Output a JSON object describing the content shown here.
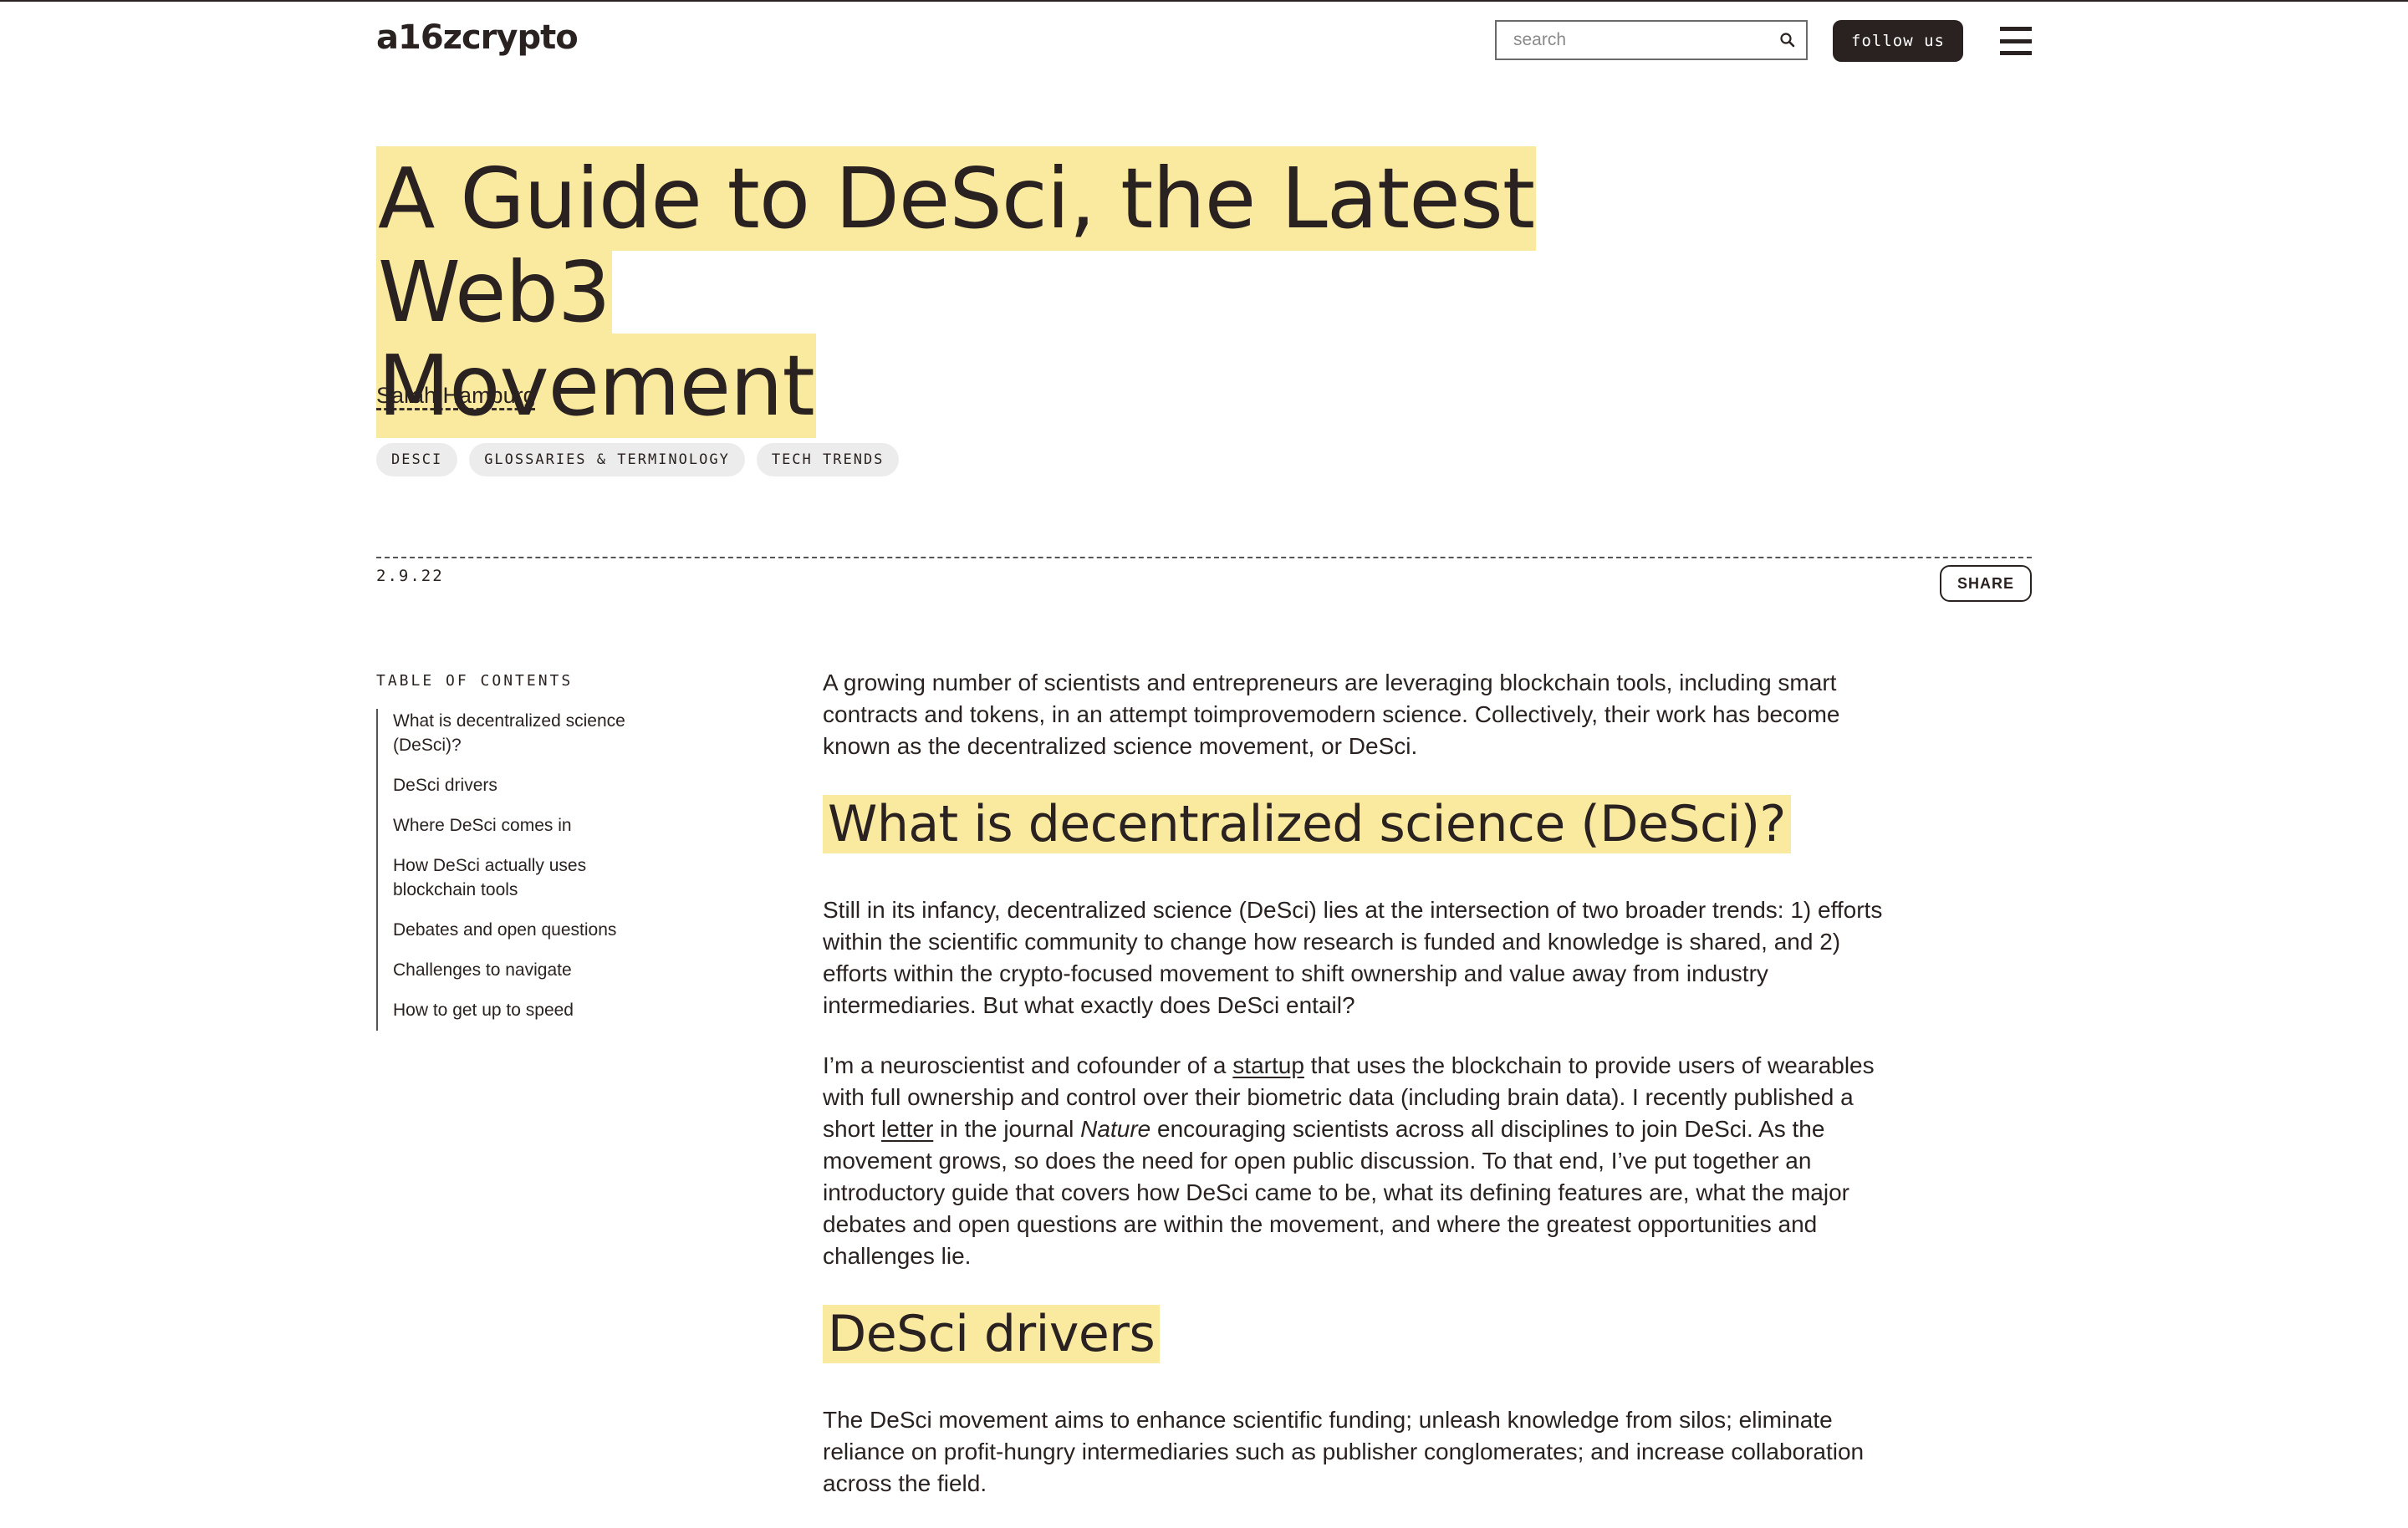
{
  "header": {
    "logo": "a16zcrypto",
    "search_placeholder": "search",
    "follow_label": "follow us"
  },
  "article": {
    "title_line1": "A Guide to DeSci, the Latest Web3",
    "title_line2": "Movement",
    "author": "Sarah Hamburg",
    "tags": [
      "DESCI",
      "GLOSSARIES & TERMINOLOGY",
      "TECH TRENDS"
    ],
    "date": "2.9.22",
    "share_label": "SHARE"
  },
  "toc": {
    "title": "TABLE OF CONTENTS",
    "items": [
      "What is decentralized science (DeSci)?",
      "DeSci drivers",
      "Where DeSci comes in",
      "How DeSci actually uses blockchain tools",
      "Debates and open questions",
      "Challenges to navigate",
      "How to get up to speed"
    ]
  },
  "body": {
    "intro": "A growing number of scientists and entrepreneurs are leveraging blockchain tools, including smart contracts and tokens, in an attempt toimprovemodern science. Collectively, their work has become known as the decentralized science movement, or DeSci.",
    "h2_1": "What is decentralized science (DeSci)?",
    "p1": "Still in its infancy, decentralized science (DeSci) lies at the intersection of two broader trends: 1) efforts within the scientific community to change how research is funded and knowledge is shared, and 2) efforts within the crypto-focused movement to shift ownership and value away from industry intermediaries. But what exactly does DeSci entail?",
    "p2_a": "I’m a neuroscientist and cofounder of a ",
    "p2_link1": "startup",
    "p2_b": " that uses the blockchain to provide users of wearables with full ownership and control over their biometric data (including brain data). I recently published a short ",
    "p2_link2": "letter",
    "p2_c": " in the journal ",
    "p2_journal": "Nature",
    "p2_d": " encouraging scientists across all disciplines to join DeSci. As the movement grows, so does the need for open public discussion. To that end, I’ve put together an introductory guide that covers how DeSci came to be, what its defining features are, what the major debates and open questions are within the movement, and where the greatest opportunities and challenges lie.",
    "h2_2": "DeSci drivers",
    "p3": "The DeSci movement aims to enhance scientific funding; unleash knowledge from silos; eliminate reliance on profit-hungry intermediaries such as publisher conglomerates; and increase collaboration across the field."
  }
}
